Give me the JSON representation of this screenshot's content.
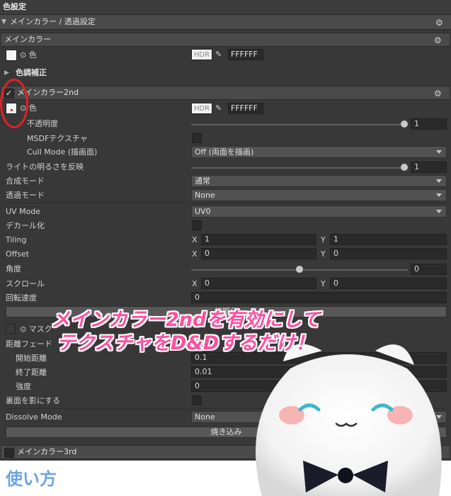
{
  "panel_title": "色設定",
  "section_title": "メインカラー / 透過設定",
  "main_color": {
    "header": "メインカラー",
    "color_label": "⊙ 色",
    "hdr": "HDR",
    "hex": "FFFFFF",
    "adjust_label": "色調補正"
  },
  "main_color_2nd": {
    "header": "メインカラー2nd",
    "enabled": true,
    "color_label": "⊙ 色",
    "hdr": "HDR",
    "hex": "FFFFFF",
    "opacity_label": "不透明度",
    "opacity_value": "1",
    "msdf_label": "MSDFテクスチャ",
    "cull_label": "Cull Mode (描画面)",
    "cull_value": "Off (両面を描画)",
    "light_label": "ライトの明るさを反映",
    "light_value": "1",
    "blend_label": "合成モード",
    "blend_value": "通常",
    "alpha_label": "透過モード",
    "alpha_value": "None",
    "uv_label": "UV Mode",
    "uv_value": "UV0",
    "decal_label": "デカール化",
    "tiling_label": "Tiling",
    "tiling_x": "1",
    "tiling_y": "1",
    "offset_label": "Offset",
    "offset_x": "0",
    "offset_y": "0",
    "angle_label": "角度",
    "angle_value": "0",
    "scroll_label": "スクロール",
    "scroll_x": "0",
    "scroll_y": "0",
    "rotate_label": "回転速度",
    "rotate_value": "0",
    "reset_button": "初期化",
    "mask_label": "⊙ マスク",
    "distance_label": "距離フェード",
    "start_label": "開始距離",
    "start_value": "0.1",
    "end_label": "終了距離",
    "end_value": "0.01",
    "strength_label": "強度",
    "strength_value": "0",
    "backface_label": "裏面を影にする",
    "dissolve_label": "Dissolve Mode",
    "dissolve_value": "None",
    "bake_button": "焼き込み"
  },
  "main_color_3rd": {
    "header": "メインカラー3rd"
  },
  "axis": {
    "x": "X",
    "y": "Y"
  },
  "annotation": {
    "line1": "メインカラー2ndを有効にして",
    "line2": "テクスチャをD&Dするだけ！"
  },
  "usage_label": "使い方",
  "colors": {
    "panel_bg": "#383838",
    "header_bg": "#4a4a4a",
    "annotation_pink": "#ff4fa0",
    "usage_blue": "#6aa4e6",
    "circle_red": "#e52222"
  }
}
